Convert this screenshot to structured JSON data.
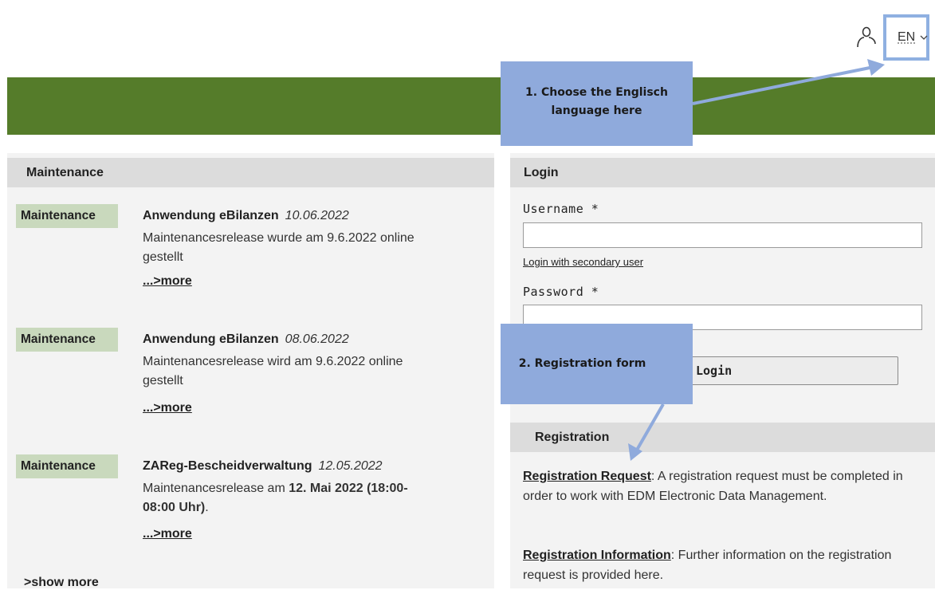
{
  "header": {
    "language": "EN"
  },
  "maintenance": {
    "title": "Maintenance",
    "items": [
      {
        "badge": "Maintenance",
        "app": "Anwendung eBilanzen",
        "date": "10.06.2022",
        "line1": "Maintenancesrelease wurde am 9.6.2022 online",
        "line2": "gestellt",
        "more": "...>more"
      },
      {
        "badge": "Maintenance",
        "app": "Anwendung eBilanzen",
        "date": "08.06.2022",
        "line1": "Maintenancesrelease wird am 9.6.2022 online",
        "line2": "gestellt",
        "more": "...>more"
      },
      {
        "badge": "Maintenance",
        "app": "ZAReg-Bescheidverwaltung",
        "date": "12.05.2022",
        "line1_prefix": "Maintenancesrelease am ",
        "line1_bold": "12. Mai 2022 (18:00-",
        "line2_bold": "08:00 Uhr)",
        "line2_suffix": ".",
        "more": "...>more"
      }
    ],
    "show_more": ">show more"
  },
  "login": {
    "title": "Login",
    "username_label": "Username *",
    "username_value": "",
    "secondary_user_link": "Login with secondary user",
    "password_label": "Password *",
    "password_value": "",
    "button_label": "Login"
  },
  "registration": {
    "title": "Registration",
    "request_link": "Registration Request",
    "request_text": ": A registration request must be completed in order to work with EDM Electronic Data Management.",
    "info_link": "Registration Information",
    "info_text": ": Further information on the registration request is provided here."
  },
  "annotations": {
    "callout1_line1": "1. Choose the Englisch",
    "callout1_line2": "language here",
    "callout2": "2. Registration form",
    "color": "#8faadc"
  },
  "colors": {
    "banner": "#557c2a",
    "badge": "#c9d9bd",
    "section_header": "#dcdcdc",
    "panel": "#f3f3f3"
  },
  "icons": {
    "user": "user-icon",
    "chevron": "chevron-down-icon"
  }
}
